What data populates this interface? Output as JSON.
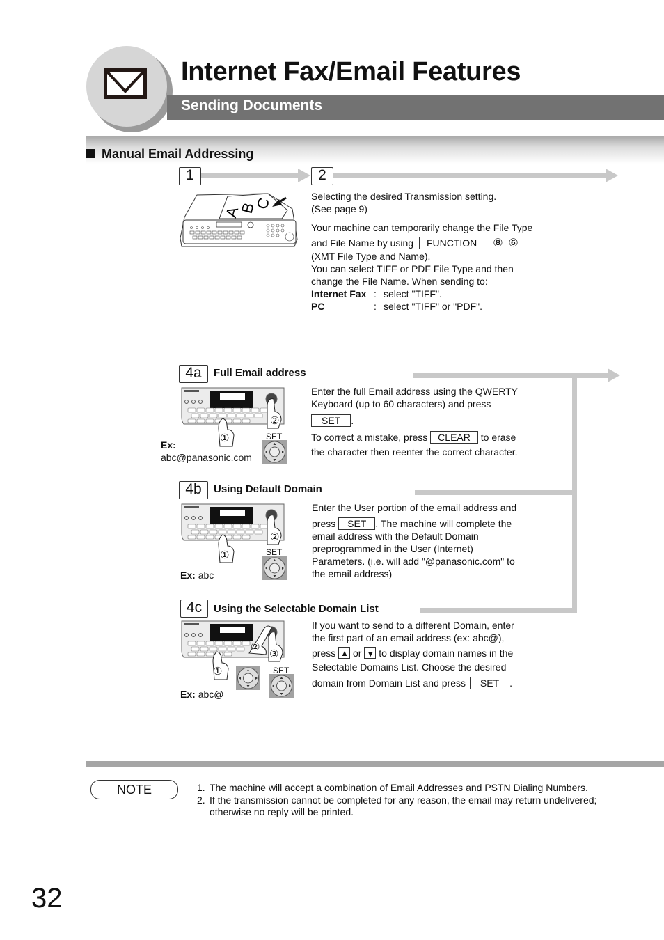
{
  "header": {
    "title": "Internet Fax/Email Features",
    "subtitle": "Sending Documents",
    "icon": "envelope-icon"
  },
  "section": {
    "title": "Manual Email Addressing"
  },
  "step1": {
    "label": "1",
    "illustration": "fax-machine-document-feed"
  },
  "step2": {
    "label": "2",
    "line1": "Selecting the desired Transmission setting.",
    "line2": "(See page 9)",
    "para_a": "Your machine can temporarily change the File Type",
    "para_b_pre": "and File Name by using",
    "function_key": "FUNCTION",
    "digit_keys": [
      "⑧",
      "⑥"
    ],
    "para_c": "(XMT File Type and Name).",
    "para_d": "You can select TIFF or PDF File Type and then",
    "para_e": "change the File Name. When sending to:",
    "options": [
      {
        "label": "Internet Fax",
        "sep": ":",
        "value": "select \"TIFF\"."
      },
      {
        "label": "PC",
        "sep": ":",
        "value": "select \"TIFF\" or \"PDF\"."
      }
    ]
  },
  "step4a": {
    "label": "4a",
    "heading": "Full Email address",
    "ex_label": "Ex:",
    "ex_value": "abc@panasonic.com",
    "set_caption": "SET",
    "markers": [
      "①",
      "②"
    ],
    "text1": "Enter the full Email address using the QWERTY",
    "text2": "Keyboard (up to 60 characters) and press",
    "set_key": "SET",
    "text3_pre": "To correct a mistake, press",
    "clear_key": "CLEAR",
    "text3_post": "to erase",
    "text4": "the character then reenter the correct character."
  },
  "step4b": {
    "label": "4b",
    "heading": "Using Default Domain",
    "ex_label": "Ex:",
    "ex_value": "abc",
    "set_caption": "SET",
    "markers": [
      "①",
      "②"
    ],
    "text1": "Enter the User portion of the email address and",
    "text2_pre": "press",
    "set_key": "SET",
    "text2_post": ". The machine will complete the",
    "text3": "email address with the Default Domain",
    "text4": "preprogrammed in the User (Internet)",
    "text5": "Parameters. (i.e. will add \"@panasonic.com\" to",
    "text6": "the email address)"
  },
  "step4c": {
    "label": "4c",
    "heading": "Using the Selectable Domain List",
    "ex_label": "Ex:",
    "ex_value": "abc@",
    "set_caption": "SET",
    "markers": [
      "①",
      "②",
      "③"
    ],
    "text1": "If you want to send to a different Domain, enter",
    "text2": "the first part of an email address (ex: abc@),",
    "text3_pre": "press",
    "up_key": "▲",
    "text3_mid": "or",
    "down_key": "▼",
    "text3_post": "to display domain names in the",
    "text4": "Selectable Domains List. Choose the desired",
    "text5_pre": "domain from Domain List and press",
    "set_key": "SET",
    "text5_post": "."
  },
  "note": {
    "label": "NOTE",
    "items": [
      {
        "num": "1.",
        "text": "The machine will accept a combination of Email Addresses and PSTN Dialing Numbers."
      },
      {
        "num": "2.",
        "text": "If the transmission cannot be completed for any reason, the email may return undelivered; otherwise no reply will be printed."
      }
    ]
  },
  "page_number": "32"
}
